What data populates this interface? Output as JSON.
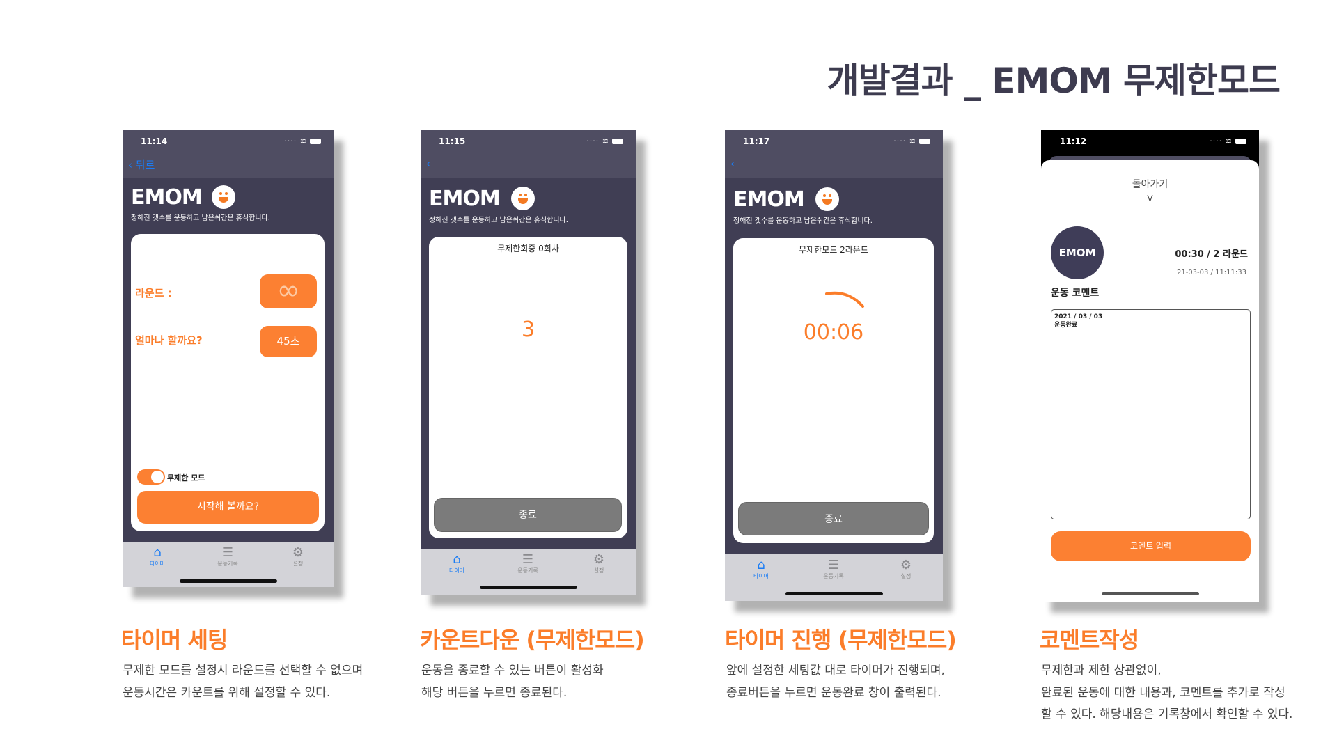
{
  "page_title": "개발결과 _ EMOM 무제한모드",
  "colors": {
    "accent": "#fb7d2a",
    "header_dark": "#403e54",
    "nav": "#4f4d62",
    "link": "#1a7cf5"
  },
  "common": {
    "app_title": "EMOM",
    "subtitle": "정해진 갯수를 운동하고 남은쉬간은 휴식합니다.",
    "tabs": [
      {
        "label": "타이머",
        "icon": "house-icon"
      },
      {
        "label": "운동기록",
        "icon": "list-icon"
      },
      {
        "label": "설정",
        "icon": "gear-icon"
      }
    ]
  },
  "phones": [
    {
      "time": "11:14",
      "back_label": "뒤로",
      "round_label": "라운드 :",
      "round_value_icon": "infinity-icon",
      "duration_label": "얼마나 할까요?",
      "duration_value": "45초",
      "unlimited_toggle_label": "무제한 모드",
      "unlimited_toggle_on": true,
      "start_button": "시작해 볼까요?"
    },
    {
      "time": "11:15",
      "status_text": "무제한회중 0회차",
      "count": "3",
      "end_button": "종료"
    },
    {
      "time": "11:17",
      "status_text": "무제한모드 2라운드",
      "timer": "00:06",
      "end_button": "종료"
    },
    {
      "time": "11:12",
      "back_label": "돌아가기",
      "back_chevron": "V",
      "badge": "EMOM",
      "summary": "00:30 / 2 라운드",
      "datetime": "21-03-03 / 11:11:33",
      "comment_label": "운동 코멘트",
      "comment_text_line1": "2021 / 03 / 03",
      "comment_text_line2": "운동완료",
      "submit_button": "코멘트 입력"
    }
  ],
  "captions": [
    {
      "title": "타이머 세팅",
      "lines": [
        "무제한 모드를 설정시 라운드를 선택할 수 없으며",
        "운동시간은 카운트를 위해 설정할 수 있다."
      ]
    },
    {
      "title": "카운트다운 (무제한모드)",
      "lines": [
        "운동을 종료할 수 있는 버튼이 활성화",
        "해당 버튼을 누르면 종료된다."
      ]
    },
    {
      "title": "타이머 진행 (무제한모드)",
      "lines": [
        "앞에 설정한 세팅값 대로 타이머가 진행되며,",
        "종료버튼을 누르면 운동완료 창이 출력된다."
      ]
    },
    {
      "title": "코멘트작성",
      "lines": [
        "무제한과 제한 상관없이,",
        "완료된 운동에 대한 내용과, 코멘트를 추가로 작성",
        "할 수 있다. 해당내용은 기록창에서 확인할 수 있다."
      ]
    }
  ]
}
